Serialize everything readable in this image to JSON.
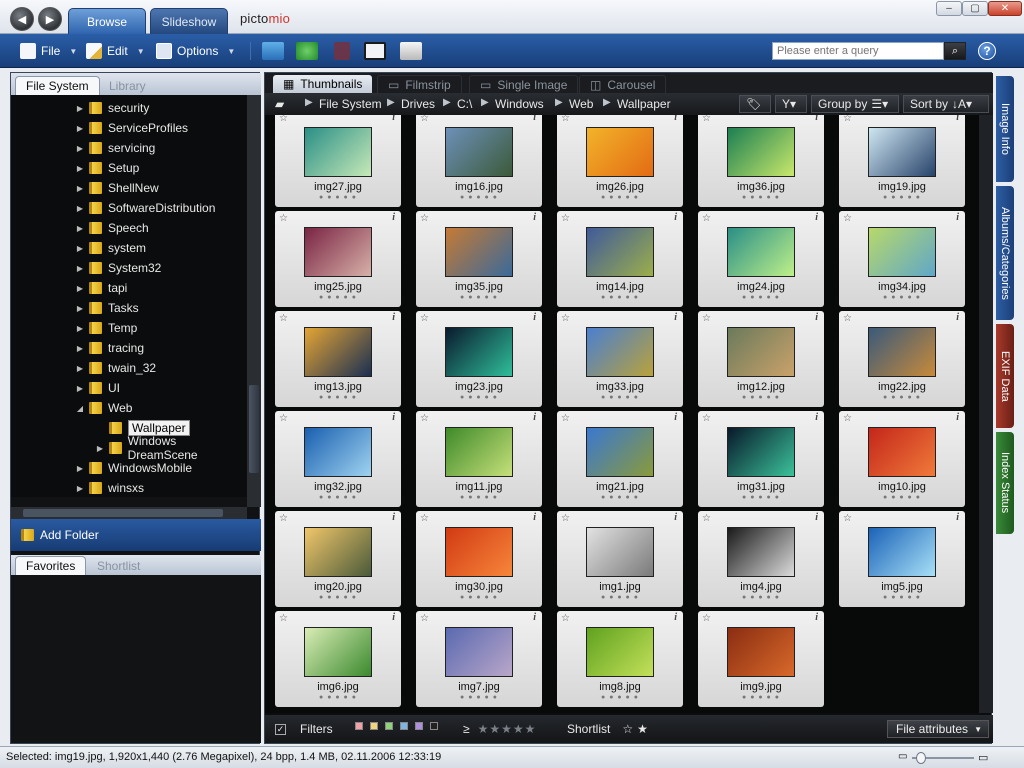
{
  "titlebar": {
    "tabs": [
      "Browse",
      "Slideshow"
    ],
    "brand_a": "picto",
    "brand_b": "mio",
    "window_buttons": [
      "minimize-icon",
      "maximize-icon",
      "close-icon"
    ]
  },
  "toolbar": {
    "file": "File",
    "edit": "Edit",
    "options": "Options",
    "search_placeholder": "Please enter a query",
    "help": "?"
  },
  "left": {
    "tabs": [
      "File System",
      "Library"
    ],
    "tree": [
      {
        "label": "security",
        "expanded": false
      },
      {
        "label": "ServiceProfiles",
        "expanded": false
      },
      {
        "label": "servicing",
        "expanded": false
      },
      {
        "label": "Setup",
        "expanded": false
      },
      {
        "label": "ShellNew",
        "expanded": false
      },
      {
        "label": "SoftwareDistribution",
        "expanded": false
      },
      {
        "label": "Speech",
        "expanded": false
      },
      {
        "label": "system",
        "expanded": false
      },
      {
        "label": "System32",
        "expanded": false
      },
      {
        "label": "tapi",
        "expanded": false
      },
      {
        "label": "Tasks",
        "expanded": false
      },
      {
        "label": "Temp",
        "expanded": false
      },
      {
        "label": "tracing",
        "expanded": false
      },
      {
        "label": "twain_32",
        "expanded": false
      },
      {
        "label": "UI",
        "expanded": false
      },
      {
        "label": "Web",
        "expanded": true
      },
      {
        "label": "Wallpaper",
        "expanded": false
      },
      {
        "label": "Windows DreamScene",
        "expanded": false
      },
      {
        "label": "WindowsMobile",
        "expanded": false
      },
      {
        "label": "winsxs",
        "expanded": false
      }
    ],
    "add_folder": "Add Folder",
    "fav_tabs": [
      "Favorites",
      "Shortlist"
    ]
  },
  "view": {
    "tabs": [
      "Thumbnails",
      "Filmstrip",
      "Single Image",
      "Carousel"
    ],
    "path": [
      "File System",
      "Drives",
      "C:\\",
      "Windows",
      "Web",
      "Wallpaper"
    ],
    "group_by": "Group by",
    "sort_by": "Sort by"
  },
  "thumbnails": [
    {
      "name": "img27.jpg",
      "c1": "#2a8f86",
      "c2": "#c7e9b8"
    },
    {
      "name": "img16.jpg",
      "c1": "#6d90b8",
      "c2": "#3b5a3a"
    },
    {
      "name": "img26.jpg",
      "c1": "#f2b32a",
      "c2": "#e36b14"
    },
    {
      "name": "img36.jpg",
      "c1": "#1c7f52",
      "c2": "#c9e86b"
    },
    {
      "name": "img19.jpg",
      "c1": "#cfe6f2",
      "c2": "#27436a"
    },
    {
      "name": "img25.jpg",
      "c1": "#7a2444",
      "c2": "#d7b1a8"
    },
    {
      "name": "img35.jpg",
      "c1": "#c57a34",
      "c2": "#3a6a9a"
    },
    {
      "name": "img14.jpg",
      "c1": "#3f5a9a",
      "c2": "#9cae4a"
    },
    {
      "name": "img24.jpg",
      "c1": "#2a8f86",
      "c2": "#bff08a"
    },
    {
      "name": "img34.jpg",
      "c1": "#b8d86a",
      "c2": "#5fa7c8"
    },
    {
      "name": "img13.jpg",
      "c1": "#e4a434",
      "c2": "#1a2f52"
    },
    {
      "name": "img23.jpg",
      "c1": "#0a1a2e",
      "c2": "#2fbf9a"
    },
    {
      "name": "img33.jpg",
      "c1": "#4a7fd0",
      "c2": "#b9a23a"
    },
    {
      "name": "img12.jpg",
      "c1": "#6b7a5c",
      "c2": "#caa26a"
    },
    {
      "name": "img22.jpg",
      "c1": "#3a5a7a",
      "c2": "#c88a3a"
    },
    {
      "name": "img32.jpg",
      "c1": "#1a5fb0",
      "c2": "#9fd3f0"
    },
    {
      "name": "img11.jpg",
      "c1": "#3f8a2a",
      "c2": "#c6e07a"
    },
    {
      "name": "img21.jpg",
      "c1": "#3a78d0",
      "c2": "#8a9a3a"
    },
    {
      "name": "img31.jpg",
      "c1": "#08192a",
      "c2": "#3bc29a"
    },
    {
      "name": "img10.jpg",
      "c1": "#c4261a",
      "c2": "#f07a3a"
    },
    {
      "name": "img20.jpg",
      "c1": "#f0c66a",
      "c2": "#4a5a3a"
    },
    {
      "name": "img30.jpg",
      "c1": "#d23a14",
      "c2": "#f7863a"
    },
    {
      "name": "img1.jpg",
      "c1": "#e2e2e2",
      "c2": "#7a7a7a"
    },
    {
      "name": "img4.jpg",
      "c1": "#1a1a1a",
      "c2": "#dcdcdc"
    },
    {
      "name": "img5.jpg",
      "c1": "#1b63b8",
      "c2": "#a8e0f7"
    },
    {
      "name": "img6.jpg",
      "c1": "#d9ecb5",
      "c2": "#3b8a2e"
    },
    {
      "name": "img7.jpg",
      "c1": "#5a6ab0",
      "c2": "#b9a6c9"
    },
    {
      "name": "img8.jpg",
      "c1": "#5fa21f",
      "c2": "#c4e05a"
    },
    {
      "name": "img9.jpg",
      "c1": "#8a2d12",
      "c2": "#d8692a"
    }
  ],
  "bottom": {
    "filters": "Filters",
    "color_labels": [
      "#f2a0a8",
      "#f2d47a",
      "#8ed37a",
      "#7ab6e6",
      "#b08ee0",
      "#222"
    ],
    "rating_prefix": "≥",
    "stars": "★★★★★",
    "shortlist": "Shortlist",
    "file_attributes": "File attributes"
  },
  "sidetabs": [
    "Image Info",
    "Albums/Categories",
    "EXIF Data",
    "Index Status"
  ],
  "status": {
    "text": "Selected: img19.jpg, 1,920x1,440 (2.76 Megapixel), 24 bpp, 1.4 MB, 02.11.2006 12:33:19"
  }
}
